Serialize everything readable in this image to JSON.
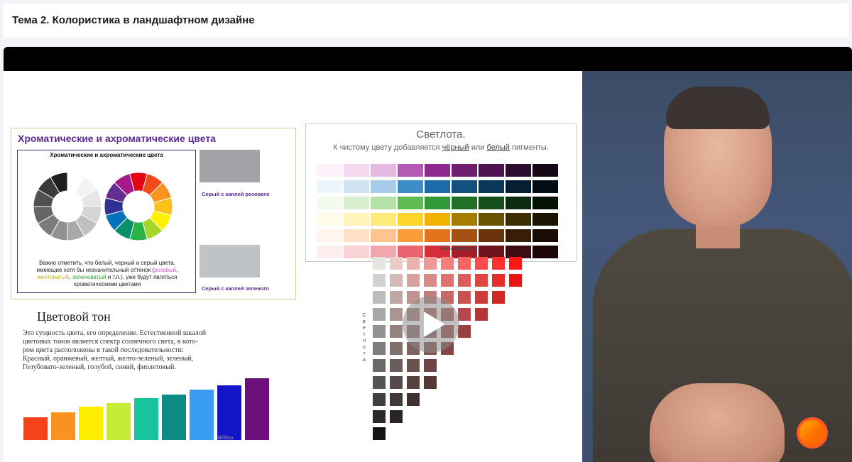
{
  "header": {
    "title": "Тема 2. Колористика в ландшафтном дизайне"
  },
  "slide": {
    "chromatic": {
      "title": "Хроматические и ахроматические цвета",
      "subtitle": "Хроматические и ахроматические цвета",
      "note_line1": "Важно отметить, что белый, черный и серый цвета,",
      "note_line2": "имеющие хотя бы незначительный оттенок (",
      "note_pink": "розовый",
      "note_yellow": "желтоватый",
      "note_green": "зеленоватый",
      "note_line3": " и т.п.), уже будут являться",
      "note_line4": "хроматическими цветами",
      "swatch_pink_label": "Серый с каплей розового",
      "swatch_green_label": "Серый с каплей зеленого",
      "swatch_pink_color": "#a6a3a8",
      "swatch_green_color": "#bfc3c5"
    },
    "lightness": {
      "title": "Светлота.",
      "sub_prefix": "К чистому цвету добавляется ",
      "sub_black": "чёрный",
      "sub_mid": " или ",
      "sub_white": "белый",
      "sub_suffix": " пигменты.",
      "saturation_label": "Насыщенность",
      "lightness_vertical": "Светлота"
    },
    "hue": {
      "title": "Цветовой тон",
      "text_line1": "Это сущность цвета, его определение. Естественной шкалой",
      "text_line2": "цветовых тонов является спектр солнечного света, в кото-",
      "text_line3": "ром цвета расположены в такой последовательности:",
      "text_line4": "Красный, оранжевый, желтый, желто-зеленый, зеленый,",
      "text_line5": "Голубовато-зеленый, голубой, синий, фиолетовый.",
      "bar_colors": [
        "#f5421a",
        "#f7931e",
        "#ffee00",
        "#c6ec36",
        "#17c49b",
        "#0e8a85",
        "#3a9bf2",
        "#1414c8",
        "#6b0f7a"
      ],
      "bar_levels": [
        0.31,
        0.38,
        0.46,
        0.51,
        0.58,
        0.63,
        0.7,
        0.75,
        0.85
      ]
    },
    "watermark": "Skillbox"
  },
  "player": {
    "play_icon": "play-icon"
  },
  "brand": {
    "logo_icon": "skillbox-logo-icon",
    "accent": "#ff5a1f"
  }
}
